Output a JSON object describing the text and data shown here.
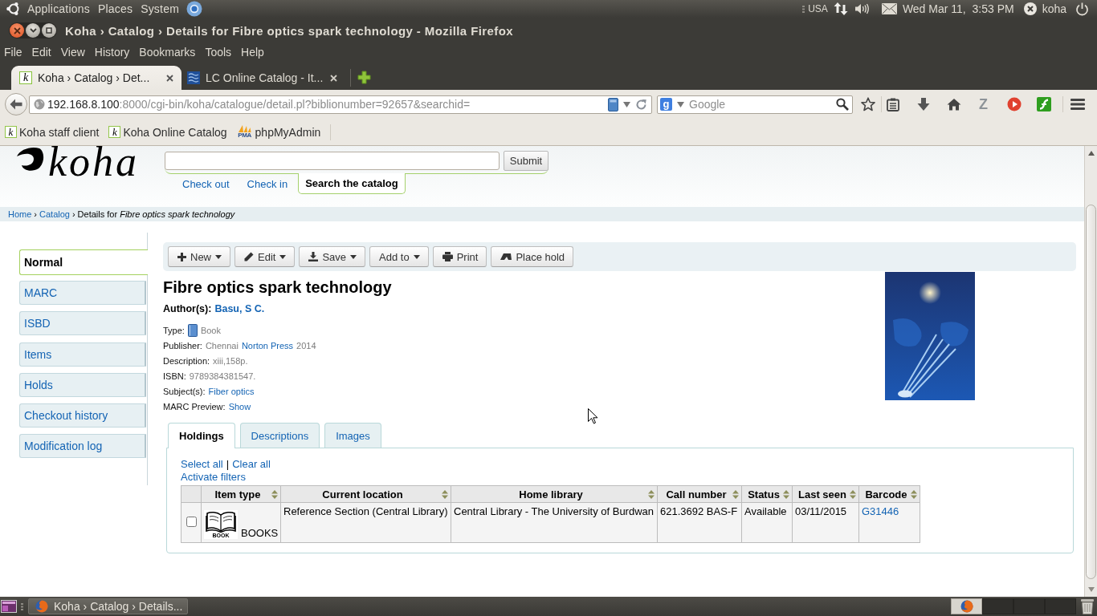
{
  "top_panel": {
    "menus": [
      "Applications",
      "Places",
      "System"
    ],
    "keyboard_layout": "USA",
    "clock": "Wed Mar 11,  3:53 PM",
    "user": "koha"
  },
  "window": {
    "title": "Koha › Catalog › Details for Fibre optics spark technology - Mozilla Firefox"
  },
  "menu_bar": [
    "File",
    "Edit",
    "View",
    "History",
    "Bookmarks",
    "Tools",
    "Help"
  ],
  "browser_tabs": [
    {
      "label": "Koha › Catalog › Det...",
      "favicon_letter": "k",
      "selected": true
    },
    {
      "label": "LC Online Catalog - It...",
      "selected": false
    }
  ],
  "navigation_bar": {
    "address_host": "192.168.8.100",
    "address_path": ":8000/cgi-bin/koha/catalogue/detail.pl?biblionumber=92657&searchid=",
    "search_engine_letter": "g",
    "search_placeholder": "Google",
    "addon_letter": "Z"
  },
  "bookmarks": [
    {
      "label": "Koha staff client",
      "kind": "letter",
      "favicon_text": "k"
    },
    {
      "label": "Koha Online Catalog",
      "kind": "letter",
      "favicon_text": "k"
    },
    {
      "label": "phpMyAdmin",
      "kind": "sail",
      "favicon_text": "PMA"
    }
  ],
  "koha": {
    "logo": "koha",
    "submit": "Submit",
    "nav_tabs": [
      {
        "label": "Check out",
        "selected": false
      },
      {
        "label": "Check in",
        "selected": false
      },
      {
        "label": "Search the catalog",
        "selected": true
      }
    ]
  },
  "breadcrumb": [
    {
      "kind": "link",
      "text": "Home"
    },
    {
      "kind": "separator",
      "text": "›"
    },
    {
      "kind": "link",
      "text": "Catalog"
    },
    {
      "kind": "separator",
      "text": "›"
    },
    {
      "kind": "current",
      "text": "Details for *Fibre optics spark technology*"
    }
  ],
  "sidebar": [
    {
      "label": "Normal",
      "selected": true
    },
    {
      "label": "MARC",
      "selected": false
    },
    {
      "label": "ISBD",
      "selected": false
    },
    {
      "label": "Items",
      "selected": false
    },
    {
      "label": "Holds",
      "selected": false
    },
    {
      "label": "Checkout history",
      "selected": false
    },
    {
      "label": "Modification log",
      "selected": false
    }
  ],
  "toolbar": [
    {
      "label": "New",
      "kind": "dropdown"
    },
    {
      "label": "Edit",
      "kind": "dropdown"
    },
    {
      "label": "Save",
      "kind": "dropdown"
    },
    {
      "label": "Add to",
      "kind": "dropdown"
    },
    {
      "label": "Print",
      "kind": "button"
    },
    {
      "label": "Place hold",
      "kind": "button"
    }
  ],
  "record": {
    "title": "Fibre optics spark technology",
    "author_label": "Author(s):",
    "author": "Basu, S C.",
    "fields": [
      {
        "label": "Type:",
        "kind": "type",
        "parts": [
          {
            "kind": "plain",
            "text": "Book"
          }
        ]
      },
      {
        "label": "Publisher:",
        "kind": "text",
        "parts": [
          {
            "kind": "plain",
            "text": "Chennai"
          },
          {
            "kind": "link",
            "text": "Norton Press"
          },
          {
            "kind": "plain",
            "text": "2014"
          }
        ]
      },
      {
        "label": "Description:",
        "kind": "text",
        "parts": [
          {
            "kind": "plain",
            "text": "xiii,158p."
          }
        ]
      },
      {
        "label": "ISBN:",
        "kind": "text",
        "parts": [
          {
            "kind": "plain",
            "text": "9789384381547."
          }
        ]
      },
      {
        "label": "Subject(s):",
        "kind": "text",
        "parts": [
          {
            "kind": "link",
            "text": "Fiber optics"
          }
        ]
      },
      {
        "label": "MARC Preview:",
        "kind": "text",
        "parts": [
          {
            "kind": "link",
            "text": "Show"
          }
        ]
      }
    ]
  },
  "detail_tabs": [
    {
      "label": "Holdings",
      "selected": true
    },
    {
      "label": "Descriptions",
      "selected": false
    },
    {
      "label": "Images",
      "selected": false
    }
  ],
  "holdings": {
    "actions": [
      {
        "kind": "link",
        "text": "Select all"
      },
      {
        "kind": "separator",
        "text": "|"
      },
      {
        "kind": "link",
        "text": "Clear all"
      }
    ],
    "filters": "Activate filters",
    "columns": [
      "Item type",
      "Current location",
      "Home library",
      "Call number",
      "Status",
      "Last seen",
      "Barcode"
    ],
    "rows": [
      {
        "checked": false,
        "item_type_icon_caption": "BOOK",
        "item_type": "BOOKS",
        "current_location": "Reference Section (Central Library)",
        "home_library": "Central Library - The University of Burdwan",
        "call_number": "621.3692 BAS-F",
        "status": "Available",
        "last_seen": "03/11/2015",
        "barcode": "G31446"
      }
    ]
  },
  "taskbar": {
    "tasks": [
      "Koha › Catalog › Details..."
    ],
    "workspaces": [
      {
        "selected": true,
        "has_window": true
      },
      {
        "selected": false,
        "has_window": false
      },
      {
        "selected": false,
        "has_window": false
      },
      {
        "selected": false,
        "has_window": false
      }
    ]
  }
}
